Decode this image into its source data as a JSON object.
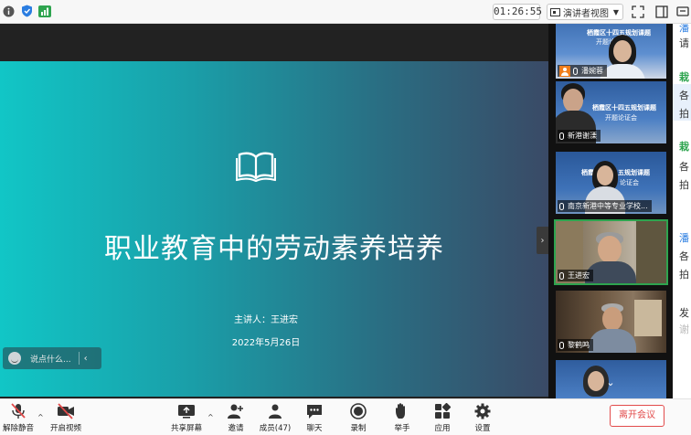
{
  "topbar": {
    "timer": "01:26:55",
    "view_mode": "演讲者视图",
    "icons": [
      "info-icon",
      "shield-icon",
      "signal-icon",
      "grid-icon",
      "fullscreen-icon",
      "window-icon",
      "chat-icon"
    ]
  },
  "slide": {
    "title": "职业教育中的劳动素养培养",
    "speaker": "主讲人：王进宏",
    "date": "2022年5月26日"
  },
  "chat_input": {
    "placeholder": "说点什么..."
  },
  "participants": [
    {
      "name": "潘婉蓉",
      "host": true
    },
    {
      "name": "新港谢溧"
    },
    {
      "name": "南京新港中等专业学校..."
    },
    {
      "name": "王进宏",
      "active": true
    },
    {
      "name": "黎鹤鸣"
    }
  ],
  "thumb_texts": {
    "t1": "栖霞区十四五规划课题",
    "t1b": "开题论证会",
    "t2": "栖霞区十四五规划课题",
    "t2b": "开题论证会",
    "t3": "栖霞",
    "t3b": "五规划课题",
    "t3c": "论证会"
  },
  "right_chat": {
    "lines": [
      {
        "text": "潘",
        "color": "#2a7de1"
      },
      {
        "text": "请",
        "color": "#333333"
      },
      {
        "text": "栽",
        "color": "#2ea44f"
      },
      {
        "text": "各",
        "color": "#333333"
      },
      {
        "text": "拍",
        "color": "#333333"
      },
      {
        "text": "栽",
        "color": "#2ea44f"
      },
      {
        "text": "各",
        "color": "#333333"
      },
      {
        "text": "拍",
        "color": "#333333"
      },
      {
        "text": "潘",
        "color": "#2a7de1"
      },
      {
        "text": "各",
        "color": "#333333"
      },
      {
        "text": "拍",
        "color": "#333333"
      },
      {
        "text": "发",
        "color": "#333333"
      },
      {
        "text": "谢",
        "color": "#bbbbbb"
      }
    ]
  },
  "toolbar": {
    "mute": "解除静音",
    "video": "开启视频",
    "share": "共享屏幕",
    "invite": "邀请",
    "members": "成员(47)",
    "chat": "聊天",
    "record": "录制",
    "raise_hand": "举手",
    "apps": "应用",
    "settings": "设置",
    "leave": "离开会议"
  },
  "colors": {
    "leave": "#e24b4b",
    "active_speaker": "#2ea44f",
    "host_badge": "#f07d1a"
  }
}
